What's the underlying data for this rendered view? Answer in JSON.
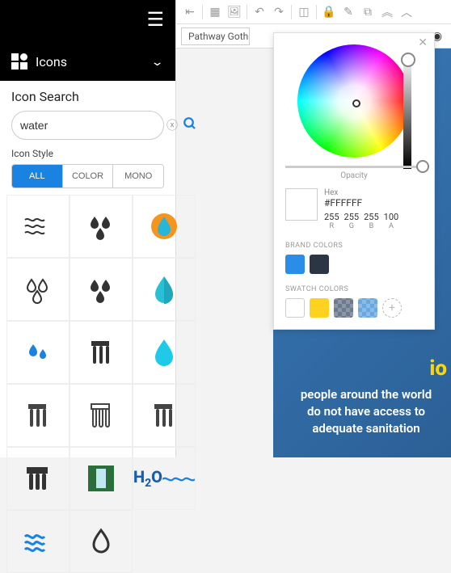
{
  "sidebar": {
    "panel_label": "Icons",
    "search_title": "Icon Search",
    "search_value": "water",
    "style_label": "Icon Style",
    "tabs": [
      "ALL",
      "COLOR",
      "MONO"
    ],
    "active_tab": 0
  },
  "toolbar": {
    "font_value": "Pathway Gothic"
  },
  "colorpicker": {
    "opacity_label": "Opacity",
    "hex_label": "Hex",
    "hex_value": "#FFFFFF",
    "r_label": "R",
    "r_value": "255",
    "g_label": "G",
    "g_value": "255",
    "b_label": "B",
    "b_value": "255",
    "a_label": "A",
    "a_value": "100",
    "brand_label": "BRAND COLORS",
    "swatch_label": "SWATCH COLORS",
    "brand_colors": [
      "#2a8ee8",
      "#2b3544"
    ],
    "swatch_colors": [
      "#ffffff",
      "#ffd21f",
      "#6c7a8c",
      "#6aa7de"
    ]
  },
  "design": {
    "yellow_fragment": "io",
    "line1": "people around the world",
    "line2": "do not have access to",
    "line3": "adequate sanitation"
  },
  "icons_grid": {
    "h2o": "H₂O"
  }
}
